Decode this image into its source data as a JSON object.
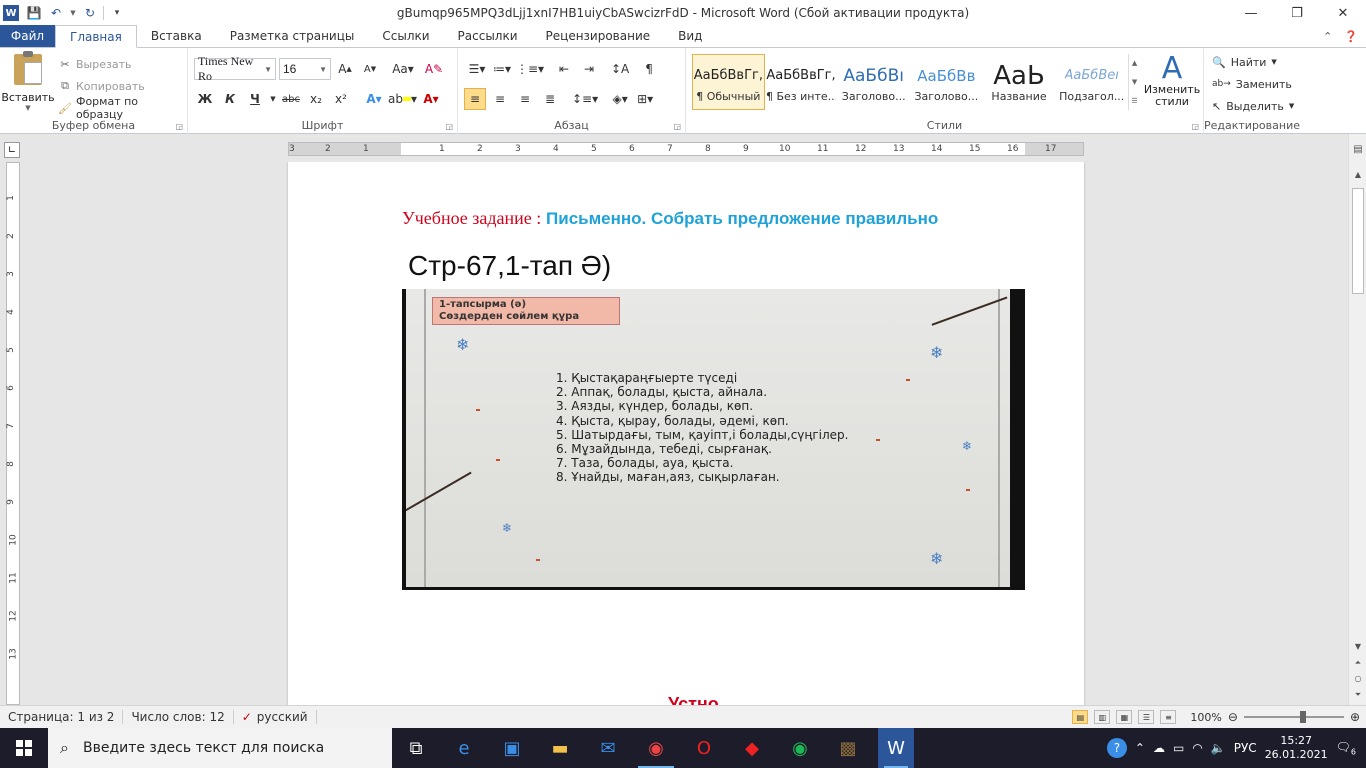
{
  "window": {
    "title": "gBumqp965MPQ3dLjj1xnI7HB1uiyCbASwcizrFdD  -  Microsoft Word (Сбой активации продукта)"
  },
  "tabs": [
    "Файл",
    "Главная",
    "Вставка",
    "Разметка страницы",
    "Ссылки",
    "Рассылки",
    "Рецензирование",
    "Вид"
  ],
  "clipboard": {
    "paste": "Вставить",
    "cut": "Вырезать",
    "copy": "Копировать",
    "format_painter": "Формат по образцу",
    "label": "Буфер обмена"
  },
  "font": {
    "name": "Times New Ro",
    "size": "16",
    "label": "Шрифт",
    "bold": "Ж",
    "italic": "К",
    "underline": "Ч"
  },
  "paragraph": {
    "label": "Абзац"
  },
  "styles": {
    "label": "Стили",
    "items": [
      {
        "preview": "АаБбВвГг,",
        "name": "¶ Обычный"
      },
      {
        "preview": "АаБбВвГг,",
        "name": "¶ Без инте..."
      },
      {
        "preview": "АаБбВı",
        "name": "Заголово..."
      },
      {
        "preview": "АаБбВв",
        "name": "Заголово..."
      },
      {
        "preview": "АаЬ",
        "name": "Название"
      },
      {
        "preview": "АаБбВеı",
        "name": "Подзагол..."
      }
    ],
    "change": "Изменить стили"
  },
  "editing": {
    "label": "Редактирование",
    "find": "Найти",
    "replace": "Заменить",
    "select": "Выделить"
  },
  "ruler_numbers": [
    "3",
    "2",
    "1",
    "1",
    "2",
    "3",
    "4",
    "5",
    "6",
    "7",
    "8",
    "9",
    "10",
    "11",
    "12",
    "13",
    "14",
    "15",
    "16",
    "17"
  ],
  "vruler_numbers": [
    "1",
    "2",
    "3",
    "4",
    "5",
    "6",
    "7",
    "8",
    "9",
    "10",
    "11",
    "12",
    "13"
  ],
  "document": {
    "task_label": "Учебное задание ",
    "task_colon": ":",
    "task_text": " Письменно. Собрать предложение правильно",
    "page_ref": "Стр-67,1-тап Ә)",
    "image": {
      "badge_line1": "1-тапсырма (ә)",
      "badge_line2": "Сөздерден сөйлем құра",
      "items": [
        "1. Қыстақараңғыерте  түседі",
        "2. Аппақ, болады, қыста, айнала.",
        "3. Аязды, күндер, болады, көп.",
        "4. Қыста, қырау, болады, әдемі, көп.",
        "5. Шатырдағы, тым, қауіпт,і болады,сүңгілер.",
        "6. Мұзайдында, тебеді, сырғанақ.",
        "7. Таза, болады, ауа, қыста.",
        "8. Ұнайды, маған,аяз, сықырлаған."
      ]
    },
    "orally": "Устно"
  },
  "status": {
    "page": "Страница: 1 из 2",
    "words": "Число слов: 12",
    "language": "русский",
    "zoom": "100%"
  },
  "taskbar": {
    "search_placeholder": "Введите здесь текст для поиска",
    "lang": "РУС",
    "time": "15:27",
    "date": "26.01.2021",
    "notifications": "6"
  }
}
